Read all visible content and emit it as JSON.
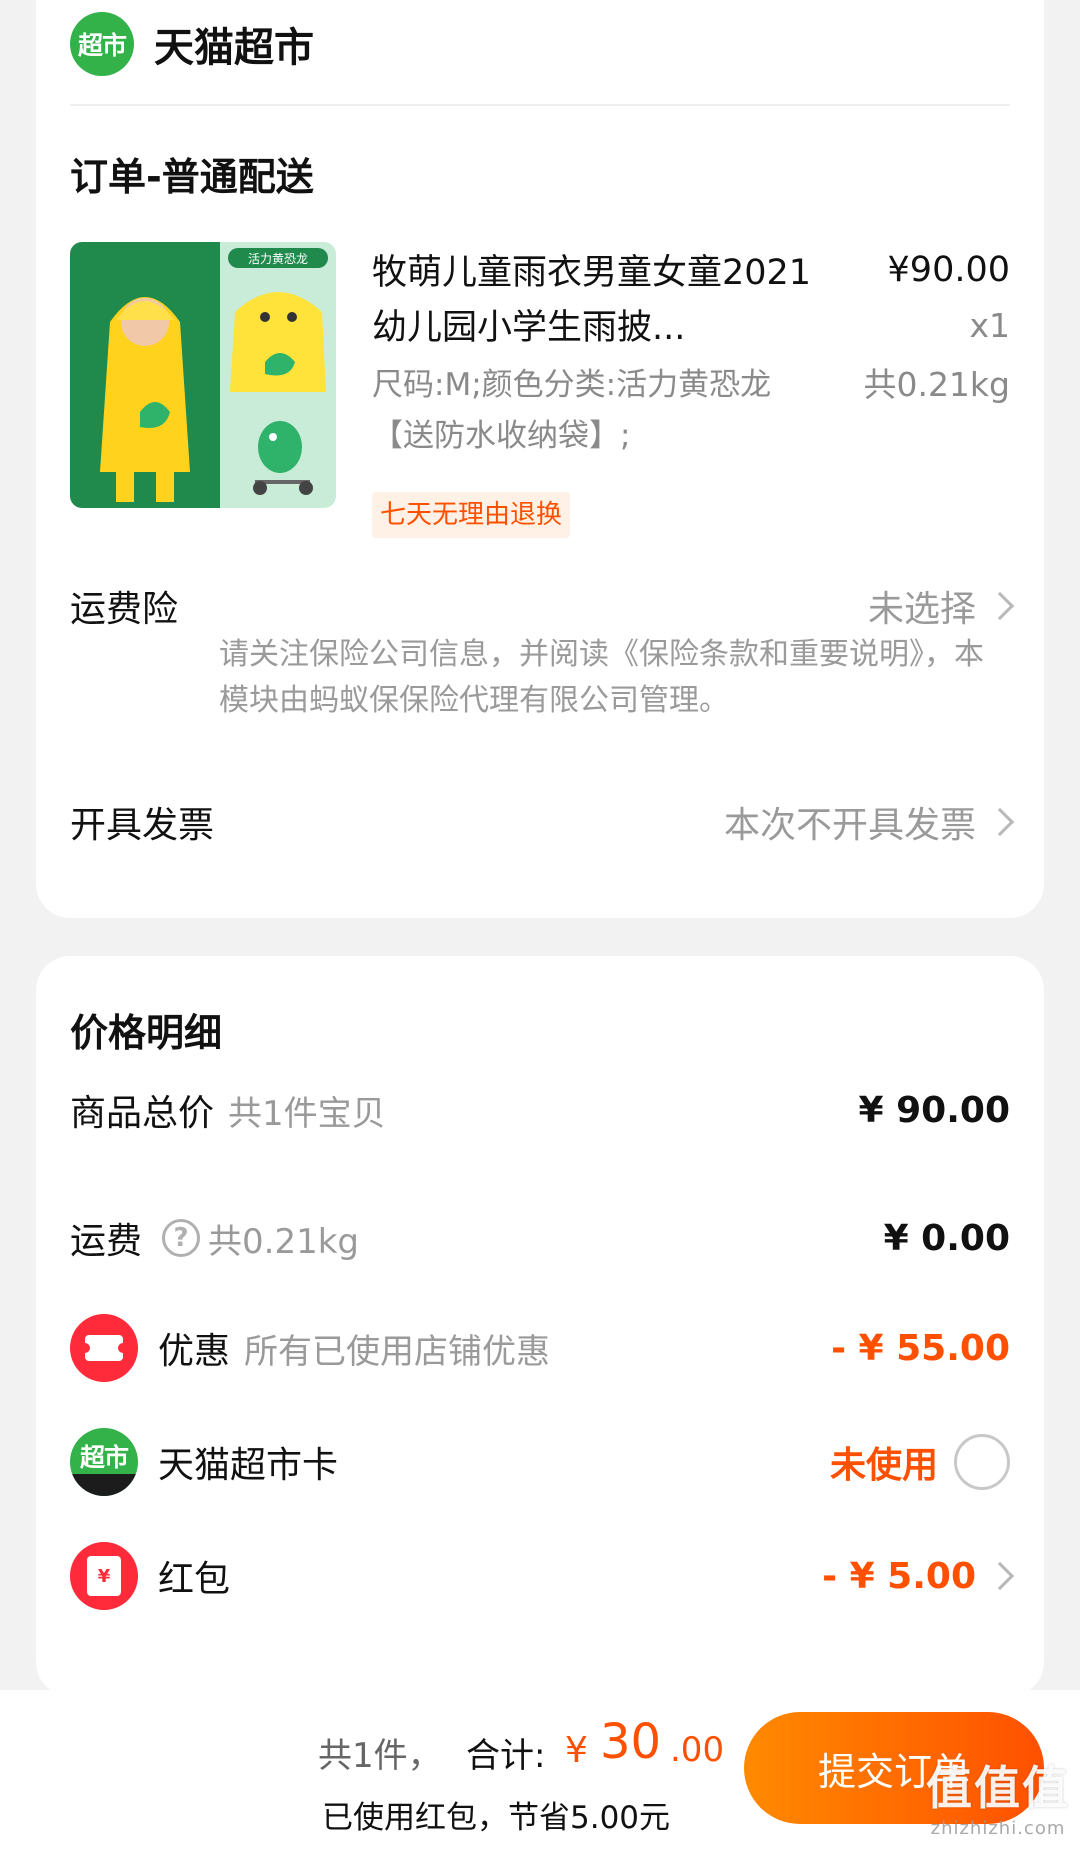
{
  "store": {
    "logo_text": "超市",
    "name": "天猫超市"
  },
  "order": {
    "title": "订单-普通配送"
  },
  "product": {
    "title": "牧萌儿童雨衣男童女童2021幼儿园小学生雨披...",
    "spec": "尺码:M;颜色分类:活力黄恐龙【送防水收纳袋】;",
    "price": "¥90.00",
    "qty": "x1",
    "weight": "共0.21kg",
    "tag": "七天无理由退换",
    "image_badge": "活力黄恐龙"
  },
  "insurance": {
    "label": "运费险",
    "value": "未选择",
    "note": "请关注保险公司信息，并阅读《保险条款和重要说明》，本模块由蚂蚁保保险代理有限公司管理。"
  },
  "invoice": {
    "label": "开具发票",
    "value": "本次不开具发票"
  },
  "price_detail": {
    "title": "价格明细",
    "goods_total": {
      "label": "商品总价",
      "sub": "共1件宝贝",
      "amount": "¥ 90.00"
    },
    "shipping": {
      "label": "运费",
      "sub": "共0.21kg",
      "amount": "¥ 0.00"
    },
    "discount": {
      "label": "优惠",
      "sub": "所有已使用店铺优惠",
      "amount": "- ¥ 55.00"
    },
    "market_card": {
      "label": "天猫超市卡",
      "logo_text": "超市",
      "status": "未使用"
    },
    "red_packet": {
      "label": "红包",
      "icon_text": "¥",
      "amount": "- ¥ 5.00"
    }
  },
  "bottom_bar": {
    "count": "共1件，",
    "total_label": "合计:",
    "currency": "¥",
    "total_int": "30",
    "total_dec": ".00",
    "saved": "已使用红包，节省5.00元",
    "submit_label": "提交订单"
  },
  "watermark": {
    "main": "值值值",
    "sub": "zhizhizhi.com"
  },
  "colors": {
    "accent": "#ff5000",
    "brand_green": "#34b24a",
    "red": "#ff2a3a"
  }
}
